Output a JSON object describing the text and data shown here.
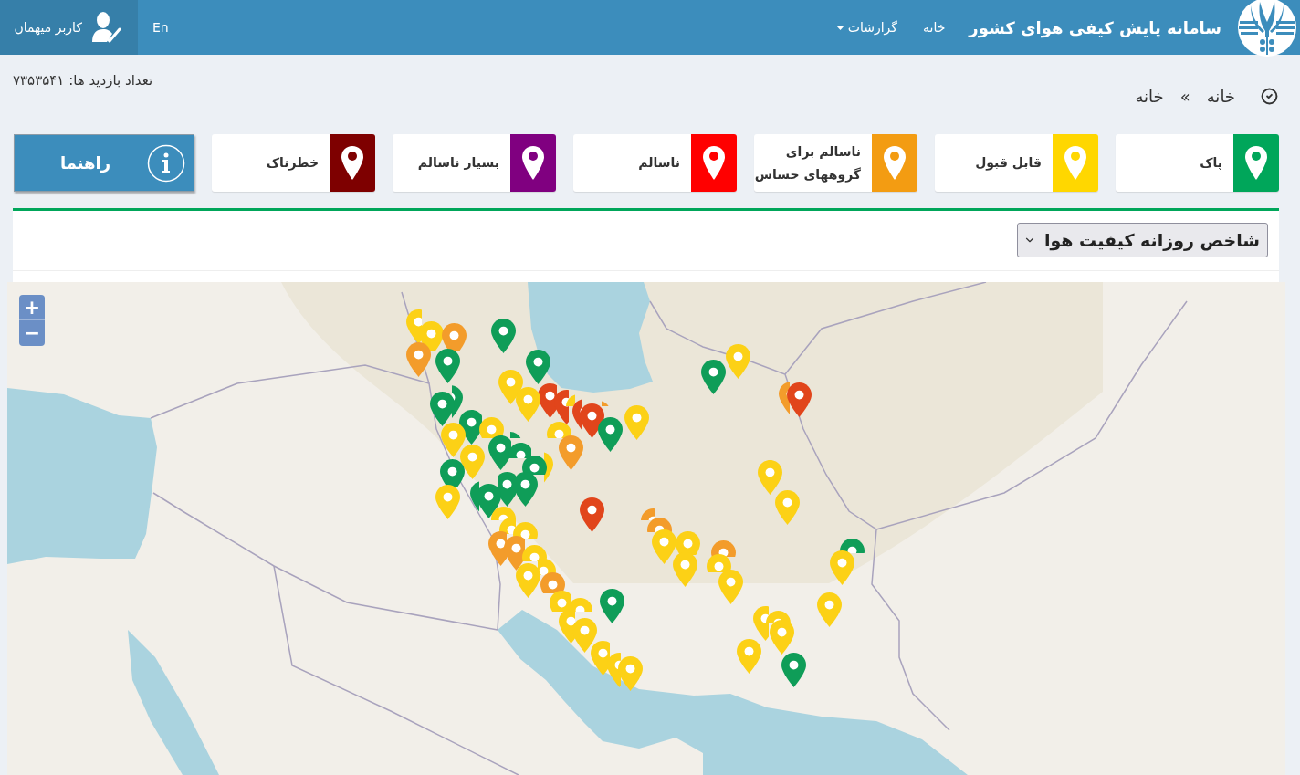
{
  "header": {
    "title": "سامانه پایش کیفی هوای کشور",
    "nav": [
      {
        "label": "خانه",
        "kind": "link"
      },
      {
        "label": "گزارشات",
        "kind": "dropdown"
      }
    ],
    "language": "En",
    "user": "کاربر میهمان"
  },
  "visits": "تعداد بازدید ها: ۷۳۵۳۵۴۱",
  "breadcrumb": {
    "items": [
      "خانه",
      "خانه"
    ],
    "separator": "»"
  },
  "legend": [
    {
      "label": "پاک",
      "color": "#00a65a"
    },
    {
      "label": "قابل قبول",
      "color": "#ffd700"
    },
    {
      "label": "ناسالم برای\nگروههای حساس",
      "color": "#f39c12"
    },
    {
      "label": "ناسالم",
      "color": "#ff0000"
    },
    {
      "label": "بسیار ناسالم",
      "color": "#800080"
    },
    {
      "label": "خطرناک",
      "color": "#7e0000"
    }
  ],
  "guide_button": {
    "label": "راهنما"
  },
  "panel": {
    "index_select": {
      "value": "شاخص روزانه کیفیت هوا"
    },
    "map": {
      "zoom_controls": [
        "+",
        "−"
      ],
      "markers": [
        {
          "color": "#fcd116"
        },
        {
          "color": "#fcd116"
        },
        {
          "color": "#f39c2b"
        },
        {
          "color": "#f39c2b"
        },
        {
          "color": "#0f9d58"
        },
        {
          "color": "#0f9d58"
        },
        {
          "color": "#0f9d58"
        },
        {
          "color": "#fcd116"
        },
        {
          "color": "#fcd116"
        },
        {
          "color": "#e1451b"
        },
        {
          "color": "#e1451b"
        },
        {
          "color": "#e1451b"
        },
        {
          "color": "#e1451b"
        },
        {
          "color": "#f39c2b"
        },
        {
          "color": "#fcd116"
        },
        {
          "color": "#0f9d58"
        },
        {
          "color": "#fcd116"
        },
        {
          "color": "#fcd116"
        },
        {
          "color": "#f39c2b"
        },
        {
          "color": "#0f9d58"
        },
        {
          "color": "#0f9d58"
        },
        {
          "color": "#0f9d58"
        },
        {
          "color": "#fcd116"
        },
        {
          "color": "#fcd116"
        },
        {
          "color": "#fcd116"
        },
        {
          "color": "#0f9d58"
        },
        {
          "color": "#0f9d58"
        },
        {
          "color": "#0f9d58"
        },
        {
          "color": "#0f9d58"
        },
        {
          "color": "#0f9d58"
        },
        {
          "color": "#fcd116"
        },
        {
          "color": "#0f9d58"
        },
        {
          "color": "#fcd116"
        },
        {
          "color": "#0f9d58"
        },
        {
          "color": "#0f9d58"
        },
        {
          "color": "#0f9d58"
        },
        {
          "color": "#e1451b"
        },
        {
          "color": "#fcd116"
        },
        {
          "color": "#fcd116"
        },
        {
          "color": "#f39c2b"
        },
        {
          "color": "#f39c2b"
        },
        {
          "color": "#fcd116"
        },
        {
          "color": "#fcd116"
        },
        {
          "color": "#fcd116"
        },
        {
          "color": "#fcd116"
        },
        {
          "color": "#f39c2b"
        },
        {
          "color": "#fcd116"
        },
        {
          "color": "#fcd116"
        },
        {
          "color": "#fcd116"
        },
        {
          "color": "#fcd116"
        },
        {
          "color": "#0f9d58"
        },
        {
          "color": "#fcd116"
        },
        {
          "color": "#fcd116"
        },
        {
          "color": "#fcd116"
        },
        {
          "color": "#f39c2b"
        },
        {
          "color": "#f39c2b"
        },
        {
          "color": "#fcd116"
        },
        {
          "color": "#fcd116"
        },
        {
          "color": "#fcd116"
        },
        {
          "color": "#f39c2b"
        },
        {
          "color": "#fcd116"
        },
        {
          "color": "#fcd116"
        },
        {
          "color": "#fcd116"
        },
        {
          "color": "#0f9d58"
        },
        {
          "color": "#f39c2b"
        },
        {
          "color": "#e1451b"
        },
        {
          "color": "#fcd116"
        },
        {
          "color": "#fcd116"
        },
        {
          "color": "#0f9d58"
        },
        {
          "color": "#fcd116"
        },
        {
          "color": "#fcd116"
        },
        {
          "color": "#fcd116"
        },
        {
          "color": "#fcd116"
        },
        {
          "color": "#fcd116"
        },
        {
          "color": "#fcd116"
        },
        {
          "color": "#0f9d58"
        }
      ]
    }
  }
}
